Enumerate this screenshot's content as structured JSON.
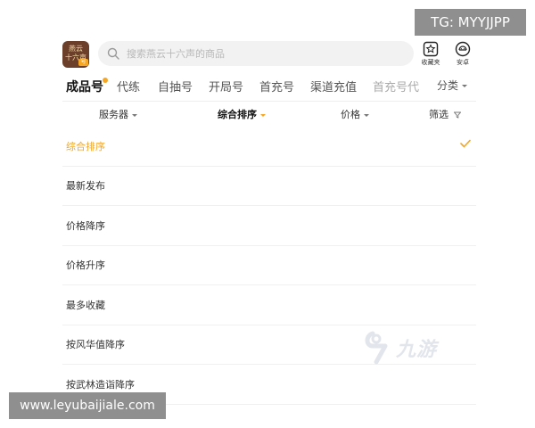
{
  "app": {
    "icon_text_line1": "燕云",
    "icon_text_line2": "十六声",
    "icon_badge": "号"
  },
  "search": {
    "placeholder": "搜索燕云十六声的商品"
  },
  "header_buttons": [
    {
      "label": "收藏夹",
      "icon": "star-box-icon"
    },
    {
      "label": "安卓",
      "icon": "android-icon"
    }
  ],
  "tabs": [
    "成品号",
    "代练",
    "自抽号",
    "开局号",
    "首充号",
    "渠道充值",
    "首充号代"
  ],
  "tabs_more": "分类",
  "filters": [
    "服务器",
    "综合排序",
    "价格",
    "筛选"
  ],
  "sort_options": [
    "综合排序",
    "最新发布",
    "价格降序",
    "价格升序",
    "最多收藏",
    "按风华值降序",
    "按武林造诣降序"
  ],
  "selected_sort": "综合排序",
  "watermarks": {
    "top_right": "TG: MYYJJPP",
    "bottom_left": "www.leyubaijiale.com",
    "logo_text": "九游"
  },
  "colors": {
    "accent": "#f5a623",
    "text": "#333333",
    "search_bg": "#f2f2f2"
  }
}
